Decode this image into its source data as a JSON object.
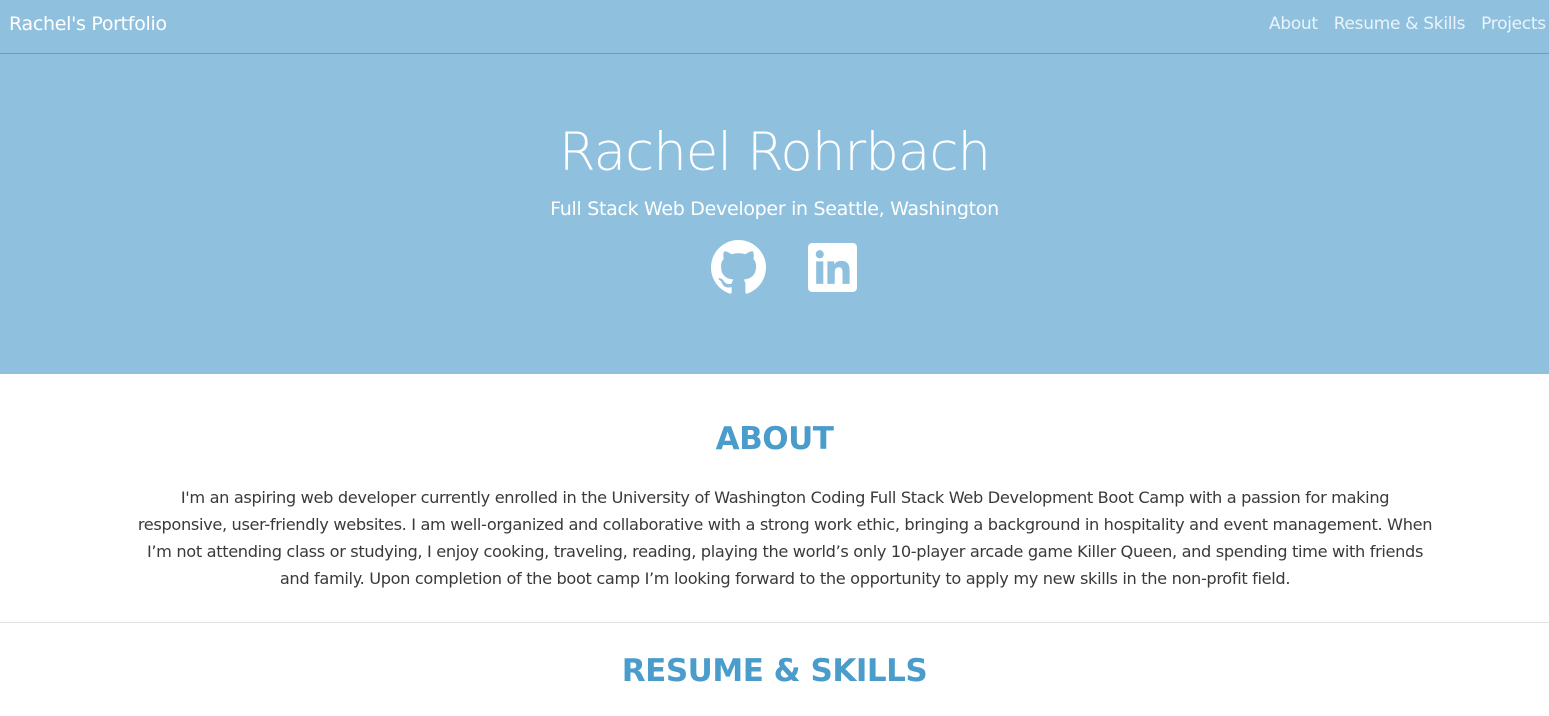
{
  "navbar": {
    "brand": "Rachel's Portfolio",
    "links": [
      "About",
      "Resume & Skills",
      "Projects"
    ]
  },
  "hero": {
    "name": "Rachel Rohrbach",
    "tagline": "Full Stack Web Developer in Seattle, Washington",
    "social_icons": [
      "github-icon",
      "linkedin-icon"
    ]
  },
  "about": {
    "title": "ABOUT",
    "text": "I'm an aspiring web developer currently enrolled in the University of Washington Coding Full Stack Web Development Boot Camp with a passion for making responsive, user-friendly websites. I am well-organized and collaborative with a strong work ethic, bringing a background in hospitality and event management. When I’m not attending class or studying, I enjoy cooking, traveling, reading, playing the world’s only 10-player arcade game Killer Queen, and spending time with friends and family. Upon completion of the boot camp I’m looking forward to the opportunity to apply my new skills in the non-profit field."
  },
  "resume": {
    "title": "RESUME & SKILLS"
  },
  "colors": {
    "header_bg": "#8fc1df",
    "accent": "#4a9ccb",
    "text": "#3a3a3a"
  }
}
